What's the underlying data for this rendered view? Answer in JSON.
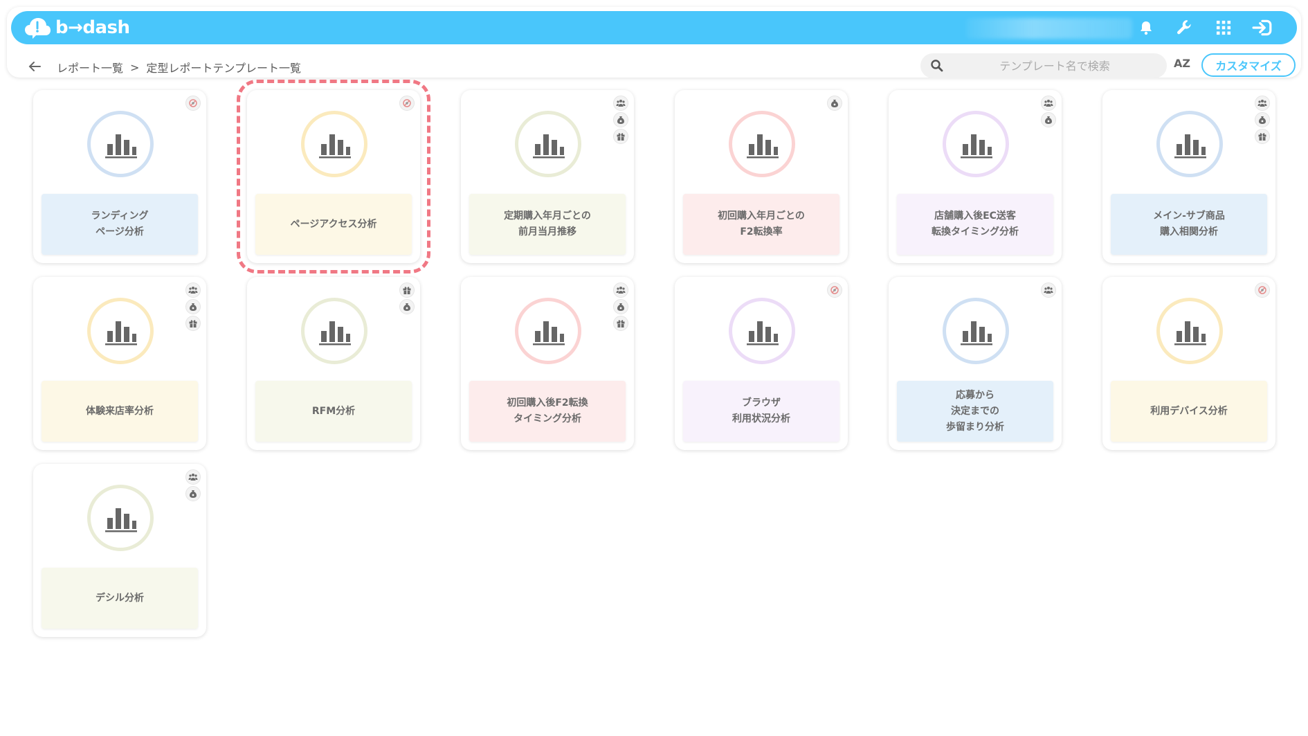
{
  "header": {
    "logo_text": "b→dash",
    "icons": [
      "bell-icon",
      "wrench-icon",
      "apps-grid-icon",
      "logout-icon"
    ]
  },
  "breadcrumb": {
    "items": [
      "レポート一覧",
      "定型レポートテンプレート一覧"
    ],
    "separator": ">"
  },
  "search": {
    "placeholder": "テンプレート名で検索"
  },
  "sort_label": "AZ",
  "customize_label": "カスタマイズ",
  "colors": {
    "accent": "#49c6fb",
    "selected_outline": "#f07884"
  },
  "cards": [
    {
      "label": "ランディング\nページ分析",
      "theme": "blue",
      "badges": [
        "no-view"
      ]
    },
    {
      "label": "ページアクセス分析",
      "theme": "yellow",
      "badges": [
        "no-view"
      ],
      "selected": true
    },
    {
      "label": "定期購入年月ごとの\n前月当月推移",
      "theme": "olive",
      "badges": [
        "users",
        "money",
        "gift"
      ]
    },
    {
      "label": "初回購入年月ごとの\nF2転換率",
      "theme": "pink",
      "badges": [
        "money"
      ]
    },
    {
      "label": "店舗購入後EC送客\n転換タイミング分析",
      "theme": "purple",
      "badges": [
        "users",
        "money"
      ]
    },
    {
      "label": "メイン-サブ商品\n購入相関分析",
      "theme": "blue",
      "badges": [
        "users",
        "money",
        "gift"
      ]
    },
    {
      "label": "体験来店率分析",
      "theme": "yellow",
      "badges": [
        "users",
        "money",
        "gift"
      ]
    },
    {
      "label": "RFM分析",
      "theme": "olive",
      "badges": [
        "gift",
        "money"
      ]
    },
    {
      "label": "初回購入後F2転換\nタイミング分析",
      "theme": "pink",
      "badges": [
        "users",
        "money",
        "gift"
      ]
    },
    {
      "label": "ブラウザ\n利用状況分析",
      "theme": "purple",
      "badges": [
        "no-view"
      ]
    },
    {
      "label": "応募から\n決定までの\n歩留まり分析",
      "theme": "blue",
      "badges": [
        "users"
      ]
    },
    {
      "label": "利用デバイス分析",
      "theme": "yellow",
      "badges": [
        "no-view"
      ]
    },
    {
      "label": "デシル分析",
      "theme": "olive",
      "badges": [
        "users",
        "money"
      ]
    }
  ]
}
